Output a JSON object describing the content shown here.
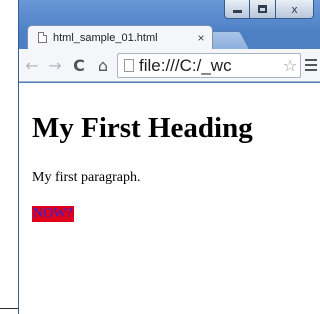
{
  "browser": {
    "tab": {
      "title": "html_sample_01.html",
      "close_glyph": "×"
    },
    "controls": {
      "minimize": "minimize-icon",
      "maximize": "maximize-icon",
      "close_glyph": "x"
    },
    "toolbar": {
      "back_glyph": "←",
      "forward_glyph": "→",
      "reload_glyph": "C",
      "home_glyph": "⌂",
      "url": "file:///C:/_wc",
      "star_glyph": "☆"
    }
  },
  "page": {
    "heading": "My First Heading",
    "paragraph": "My first paragraph.",
    "highlight_text": "NOW?",
    "highlight_bg": "#e0001b",
    "highlight_fg": "#2d24d8"
  }
}
